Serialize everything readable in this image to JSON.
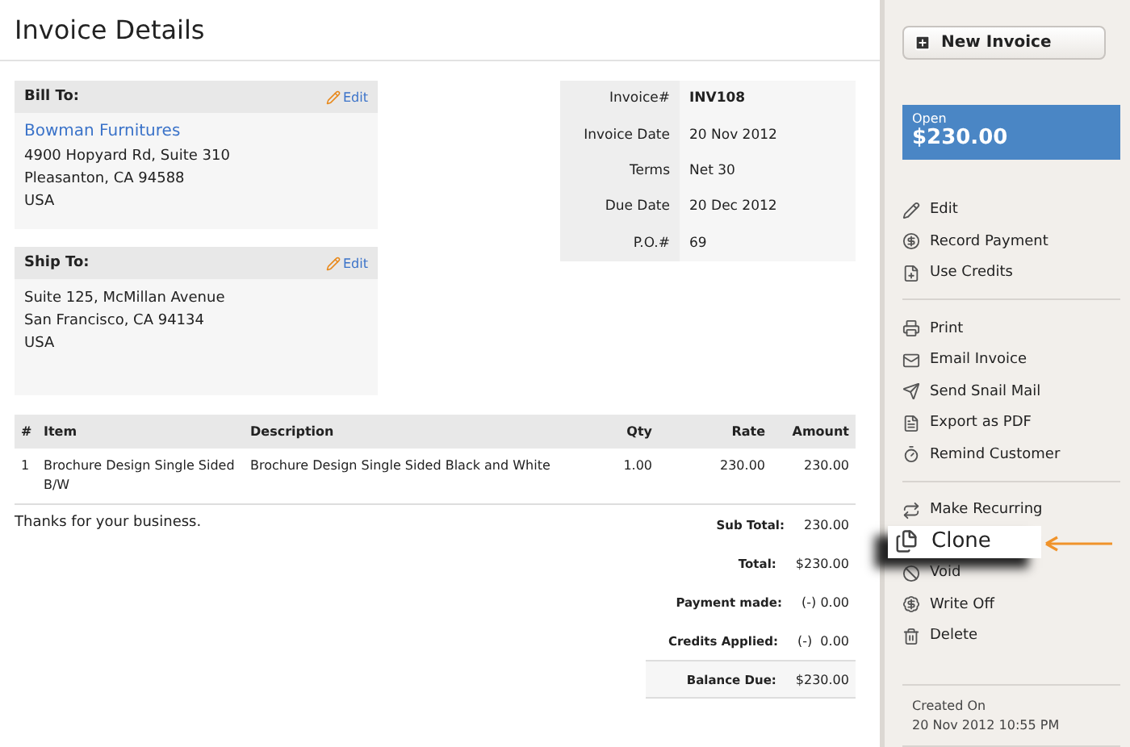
{
  "page_title": "Invoice Details",
  "bill_to": {
    "heading": "Bill To:",
    "edit": "Edit",
    "name": "Bowman Furnitures",
    "lines": [
      "4900 Hopyard Rd, Suite 310",
      "Pleasanton, CA 94588",
      "USA"
    ]
  },
  "ship_to": {
    "heading": "Ship To:",
    "edit": "Edit",
    "lines": [
      "Suite 125, McMillan Avenue",
      "San Francisco, CA 94134",
      "USA"
    ]
  },
  "meta": [
    {
      "label": "Invoice#",
      "value": "INV108",
      "bold": true
    },
    {
      "label": "Invoice Date",
      "value": "20 Nov 2012",
      "bold": false
    },
    {
      "label": "Terms",
      "value": "Net 30",
      "bold": false
    },
    {
      "label": "Due Date",
      "value": "20 Dec 2012",
      "bold": false
    },
    {
      "label": "P.O.#",
      "value": "69",
      "bold": false
    }
  ],
  "table": {
    "columns": [
      "#",
      "Item",
      "Description",
      "Qty",
      "Rate",
      "Amount"
    ],
    "rows": [
      [
        "1",
        "Brochure Design Single Sided B/W",
        "Brochure Design Single Sided Black and White",
        "1.00",
        "230.00",
        "230.00"
      ]
    ]
  },
  "notes": "Thanks for your business.",
  "totals": [
    {
      "label": "Sub Total:",
      "value": "230.00",
      "kind": "plain"
    },
    {
      "label": "Total:",
      "value": "$230.00",
      "kind": "plain"
    },
    {
      "label": "Payment made:",
      "value": "(-) 0.00",
      "kind": "plain"
    },
    {
      "label": "Credits Applied:",
      "value": "(-)  0.00",
      "kind": "plain"
    },
    {
      "label": "Balance Due:",
      "value": "$230.00",
      "kind": "shaded"
    }
  ],
  "sidebar": {
    "new_button": "New Invoice",
    "status": {
      "label": "Open",
      "amount": "$230.00"
    },
    "groups": [
      [
        {
          "label": "Edit",
          "kind": "normal"
        },
        {
          "label": "Record Payment",
          "kind": "normal"
        },
        {
          "label": "Use Credits",
          "kind": "normal"
        }
      ],
      [
        {
          "label": "Print",
          "kind": "normal"
        },
        {
          "label": "Email Invoice",
          "kind": "normal"
        },
        {
          "label": "Send Snail Mail",
          "kind": "normal"
        },
        {
          "label": "Export as PDF",
          "kind": "normal"
        },
        {
          "label": "Remind Customer",
          "kind": "normal"
        }
      ],
      [
        {
          "label": "Make Recurring",
          "kind": "normal"
        },
        {
          "label": "Clone",
          "kind": "callout"
        },
        {
          "label": "Void",
          "kind": "normal"
        },
        {
          "label": "Write Off",
          "kind": "normal"
        },
        {
          "label": "Delete",
          "kind": "normal"
        }
      ]
    ],
    "created": {
      "label": "Created On",
      "value": "20 Nov 2012 10:55 PM"
    }
  }
}
